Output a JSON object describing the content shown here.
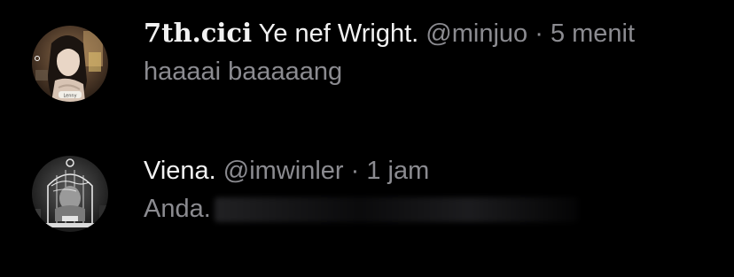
{
  "replies": [
    {
      "display_name": "7th.cici",
      "extra_name": "Ye nef Wright.",
      "handle": "@minjuo",
      "separator": "·",
      "time": "5 menit",
      "text": "haaaai baaaaang",
      "avatar_tag": "Lenny"
    },
    {
      "display_name": "Viena.",
      "handle": "@imwinler",
      "separator": "·",
      "time": "1 jam",
      "text": "Anda."
    }
  ]
}
